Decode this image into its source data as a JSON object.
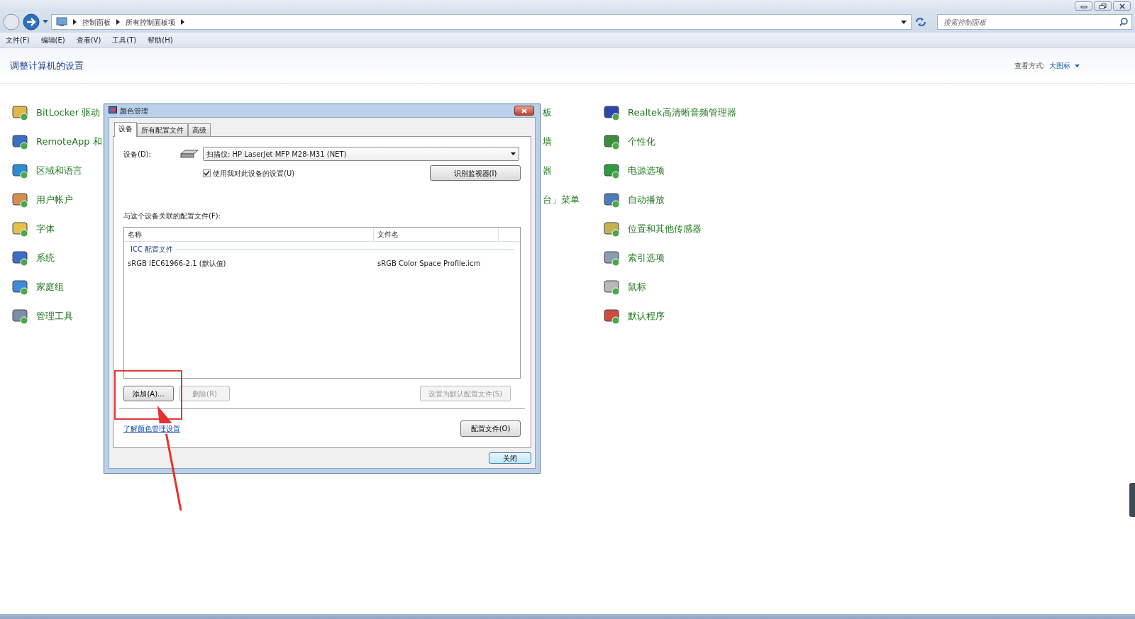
{
  "address_bar": {
    "breadcrumbs": [
      "控制面板",
      "所有控制面板项"
    ]
  },
  "search": {
    "placeholder": "搜索控制面板"
  },
  "menu": [
    "文件(F)",
    "编辑(E)",
    "查看(V)",
    "工具(T)",
    "帮助(H)"
  ],
  "header": {
    "title": "调整计算机的设置",
    "view_label": "查看方式:",
    "view_value": "大图标"
  },
  "items": {
    "column_1": [
      "BitLocker 驱动",
      "RemoteApp 和",
      "区域和语言",
      "用户帐户",
      "字体",
      "系统",
      "家庭组",
      "管理工具"
    ],
    "column_2": [
      "板",
      "墙",
      "器",
      "台」菜单"
    ],
    "column_3": [
      "Realtek高清晰音频管理器",
      "个性化",
      "电源选项",
      "自动播放",
      "位置和其他传感器",
      "索引选项",
      "鼠标",
      "默认程序"
    ]
  },
  "dialog": {
    "title": "颜色管理",
    "tabs": [
      {
        "label": "设备",
        "selected": true
      },
      {
        "label": "所有配置文件",
        "selected": false
      },
      {
        "label": "高级",
        "selected": false
      }
    ],
    "device_label": "设备(D):",
    "device_value": "扫描仪: HP LaserJet MFP M28-M31 (NET)",
    "use_settings": {
      "label": "使用我对此设备的设置(U)",
      "checked": true
    },
    "identify_button": "识别监视器(I)",
    "profiles_label": "与这个设备关联的配置文件(F):",
    "table": {
      "columns": [
        "名称",
        "文件名"
      ],
      "group": "ICC 配置文件",
      "rows": [
        [
          "sRGB IEC61966-2.1 (默认值)",
          "sRGB Color Space Profile.icm"
        ]
      ]
    },
    "buttons": [
      {
        "label": "添加(A)...",
        "disabled": false
      },
      {
        "label": "删除(R)",
        "disabled": true
      },
      {
        "label": "设置为默认配置文件(S)",
        "disabled": true
      }
    ],
    "link": "了解颜色管理设置",
    "profiles_button": "配置文件(O)",
    "close_button": "关闭"
  }
}
